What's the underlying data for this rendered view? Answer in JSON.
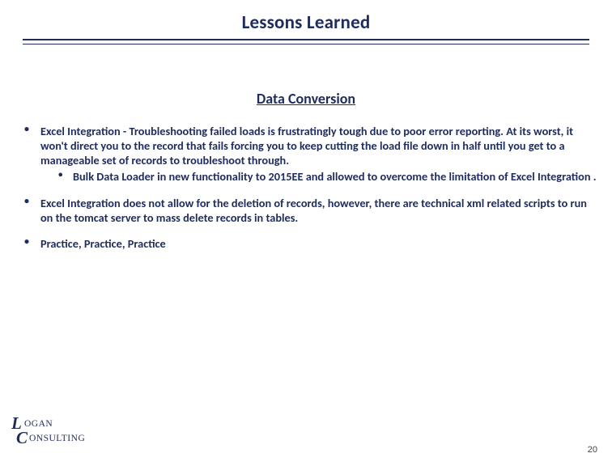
{
  "title": "Lessons Learned",
  "section_heading": "Data Conversion",
  "bullets": [
    {
      "text": "Excel Integration - Troubleshooting failed loads is frustratingly tough due to poor error reporting. At its worst, it won't direct you to the record that fails forcing you to keep cutting the load file down in half until you get to a manageable set of records to troubleshoot through.",
      "sub": [
        "Bulk Data Loader in new functionality to 2015EE and allowed to overcome the limitation of Excel Integration ."
      ]
    },
    {
      "text": "Excel Integration does not allow for the deletion of records, however, there are technical xml related scripts to run on the tomcat server to mass delete records in tables.",
      "sub": []
    },
    {
      "text": "Practice, Practice, Practice",
      "sub": []
    }
  ],
  "logo": {
    "text_top": "OGAN",
    "text_bottom": "ONSULTING"
  },
  "page_number": "20",
  "colors": {
    "brand": "#1f2c5e"
  }
}
